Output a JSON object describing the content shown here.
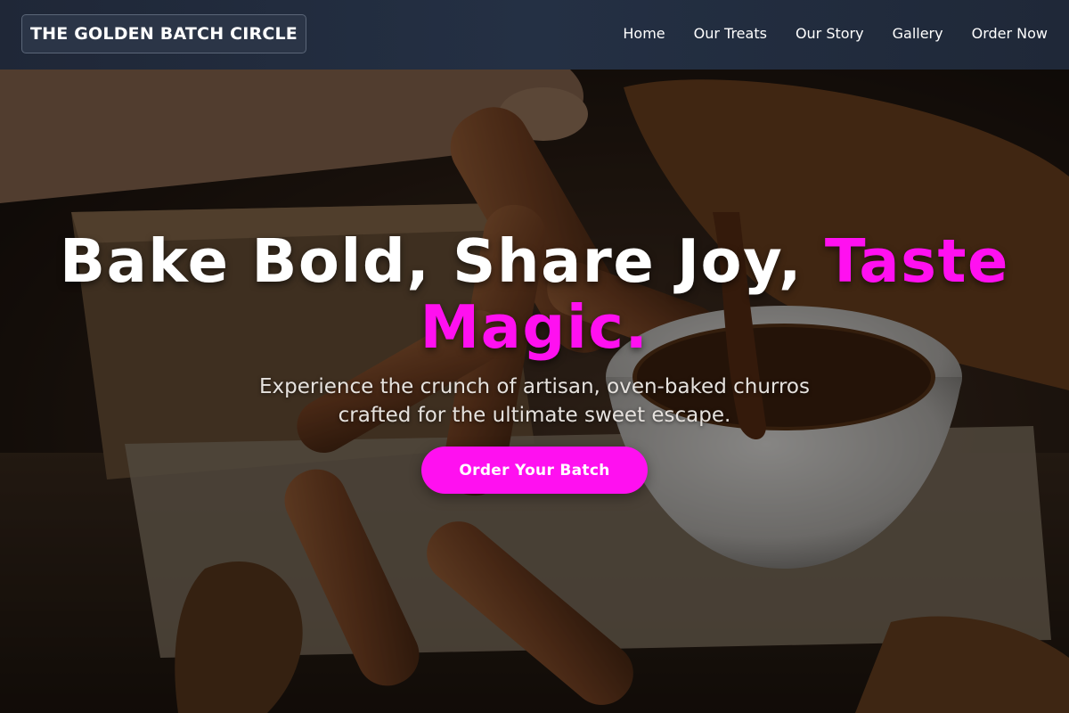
{
  "header": {
    "brand": "THE GOLDEN BATCH CIRCLE",
    "nav": [
      "Home",
      "Our Treats",
      "Our Story",
      "Gallery",
      "Order Now"
    ]
  },
  "hero": {
    "headline_main": "Bake Bold, Share Joy, ",
    "headline_accent": "Taste Magic.",
    "subtext": "Experience the crunch of artisan, oven-baked churros crafted for the ultimate sweet escape.",
    "cta": "Order Your Batch",
    "background_image": "churros-with-chocolate-dip-photo"
  },
  "colors": {
    "accent": "#ff10f0",
    "header_bg": "#1f2737",
    "text": "#ffffff"
  }
}
